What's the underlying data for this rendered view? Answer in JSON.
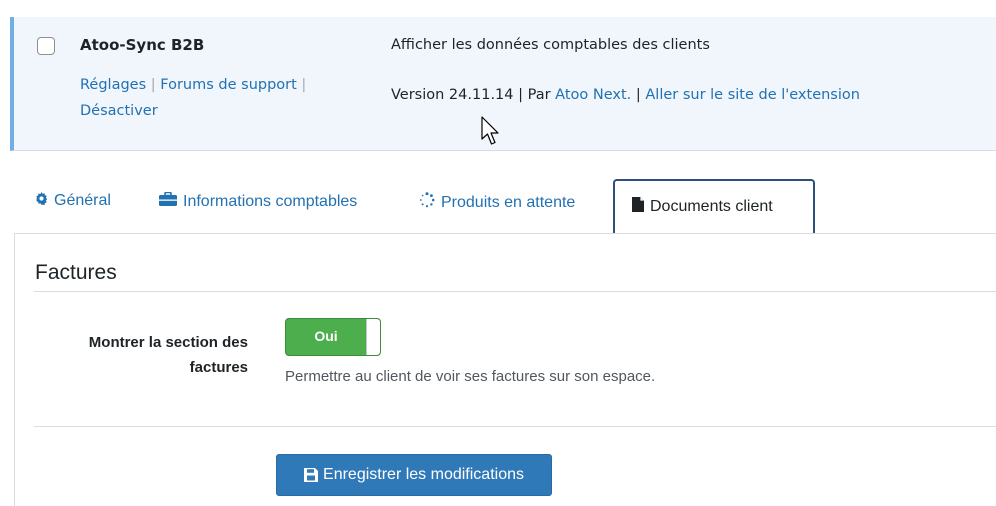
{
  "plugin": {
    "name": "Atoo-Sync B2B",
    "actions": {
      "settings": "Réglages",
      "support": "Forums de support",
      "deactivate": "Désactiver",
      "separator": "|"
    },
    "description": "Afficher les données comptables des clients",
    "version_text": "Version 24.11.14",
    "by_label": "Par",
    "author": "Atoo Next.",
    "site_link": "Aller sur le site de l'extension",
    "separator": "|",
    "row_color": "#f0f6fc",
    "accent_color": "#72aee6"
  },
  "tabs": [
    {
      "label": "Général",
      "icon": "gear-icon"
    },
    {
      "label": "Informations comptables",
      "icon": "briefcase-icon"
    },
    {
      "label": "Produits en attente",
      "icon": "spinner-icon"
    },
    {
      "label": "Documents client",
      "icon": "file-icon",
      "active": true
    }
  ],
  "section": {
    "title": "Factures",
    "field_label": "Montrer la section des factures",
    "toggle": {
      "label": "Oui",
      "state": "on",
      "color": "#4cae4c"
    },
    "help_text": "Permettre au client de voir ses factures sur son espace."
  },
  "save_button": {
    "label": "Enregistrer les modifications",
    "icon": "floppy-disk-icon",
    "color": "#3079b8"
  }
}
